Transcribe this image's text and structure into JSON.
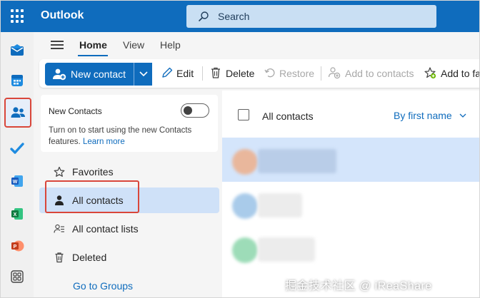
{
  "header": {
    "brand": "Outlook",
    "search_placeholder": "Search",
    "brand_color": "#0f6cbd"
  },
  "rail": {
    "items": [
      "mail-icon",
      "calendar-icon",
      "people-icon",
      "todo-icon",
      "word-icon",
      "excel-icon",
      "powerpoint-icon",
      "more-apps-icon"
    ],
    "active": "people-icon"
  },
  "ribbon": {
    "tabs": [
      {
        "label": "Home",
        "active": true
      },
      {
        "label": "View",
        "active": false
      },
      {
        "label": "Help",
        "active": false
      }
    ],
    "new_contact": "New contact",
    "edit": "Edit",
    "delete": "Delete",
    "restore": "Restore",
    "add_to_contacts": "Add to contacts",
    "add_to_favorites": "Add to fa"
  },
  "nav": {
    "promo": {
      "title": "New Contacts",
      "description": "Turn on to start using the new Contacts features.",
      "link": "Learn more",
      "toggle_on": false
    },
    "items": [
      {
        "label": "Favorites",
        "icon": "star-icon"
      },
      {
        "label": "All contacts",
        "icon": "person-icon",
        "selected": true
      },
      {
        "label": "All contact lists",
        "icon": "contact-list-icon"
      },
      {
        "label": "Deleted",
        "icon": "trash-icon"
      }
    ],
    "groups_link": "Go to Groups"
  },
  "list": {
    "title": "All contacts",
    "sort_label": "By first name",
    "rows": [
      {
        "avatar_color": "#e9b79c",
        "selected": true
      },
      {
        "avatar_color": "#a9cbea",
        "selected": false
      },
      {
        "avatar_color": "#9ddcb8",
        "selected": false
      }
    ]
  },
  "watermark": "掘金技术社区 @ iReaShare",
  "highlight_color": "#d9463a"
}
